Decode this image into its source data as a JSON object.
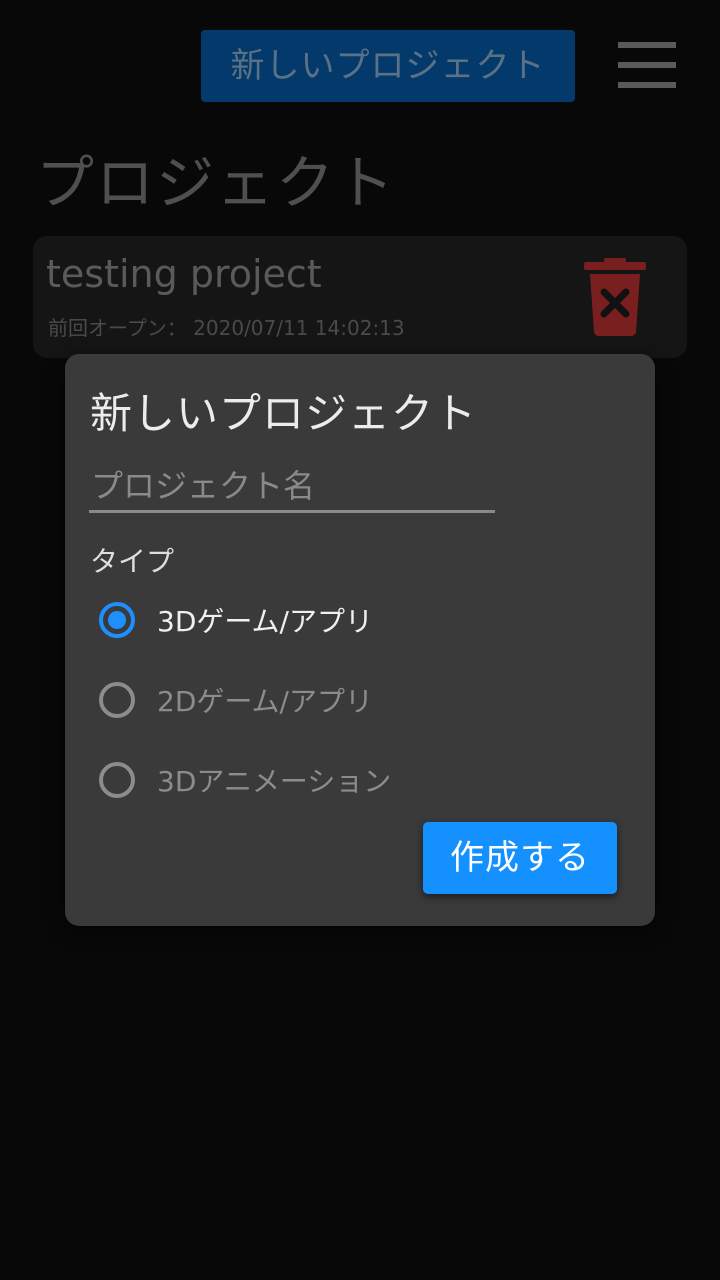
{
  "header": {
    "new_project_label": "新しいプロジェクト",
    "menu_icon": "hamburger-menu-icon"
  },
  "page": {
    "title": "プロジェクト"
  },
  "projects": [
    {
      "name": "testing project",
      "last_opened_label": "前回オープン：",
      "last_opened": "2020/07/11 14:02:13",
      "delete_icon": "trash-delete-icon"
    }
  ],
  "dialog": {
    "title": "新しいプロジェクト",
    "name_placeholder": "プロジェクト名",
    "name_value": "",
    "type_label": "タイプ",
    "options": [
      {
        "label": "3Dゲーム/アプリ",
        "selected": true
      },
      {
        "label": "2Dゲーム/アプリ",
        "selected": false
      },
      {
        "label": "3Dアニメーション",
        "selected": false
      }
    ],
    "create_label": "作成する"
  },
  "colors": {
    "accent": "#1590ff",
    "background": "#080808",
    "dialog": "#3a3a3a",
    "delete_red": "#7a1f1f"
  }
}
